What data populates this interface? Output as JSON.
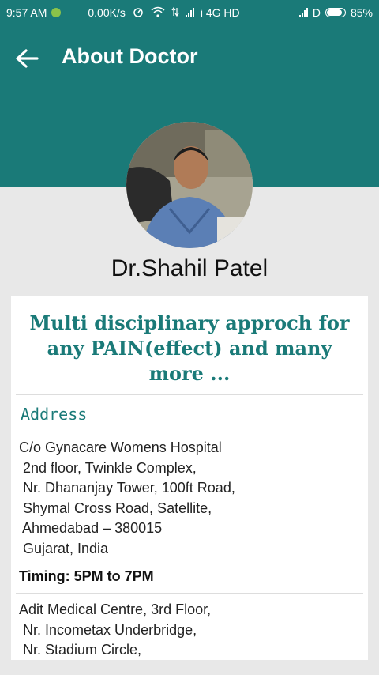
{
  "status_bar": {
    "time": "9:57 AM",
    "net_speed": "0.00K/s",
    "carrier": "i 4G HD",
    "carrier2": "D",
    "battery": "85%",
    "icons": [
      "app-notification-icon",
      "speed-icon",
      "wifi-icon",
      "data-arrows-icon",
      "signal-icon",
      "battery-icon"
    ]
  },
  "header": {
    "title": "About Doctor",
    "back_icon": "arrow-left-icon",
    "color": "#1a7a78"
  },
  "doctor": {
    "name": "Dr.Shahil Patel",
    "photo": "doctor-photo"
  },
  "card": {
    "tagline": "Multi disciplinary approch for any PAIN(effect) and many more ...",
    "address_heading": "Address",
    "address1": [
      "C/o Gynacare Womens Hospital",
      " 2nd floor, Twinkle Complex,",
      " Nr. Dhananjay Tower, 100ft Road,",
      " Shymal Cross Road, Satellite,",
      " Ahmedabad – 380015",
      " Gujarat, India"
    ],
    "timing": "Timing: 5PM to 7PM",
    "address2": [
      "Adit Medical Centre, 3rd Floor,",
      " Nr. Incometax Underbridge,",
      " Nr. Stadium Circle,"
    ]
  }
}
